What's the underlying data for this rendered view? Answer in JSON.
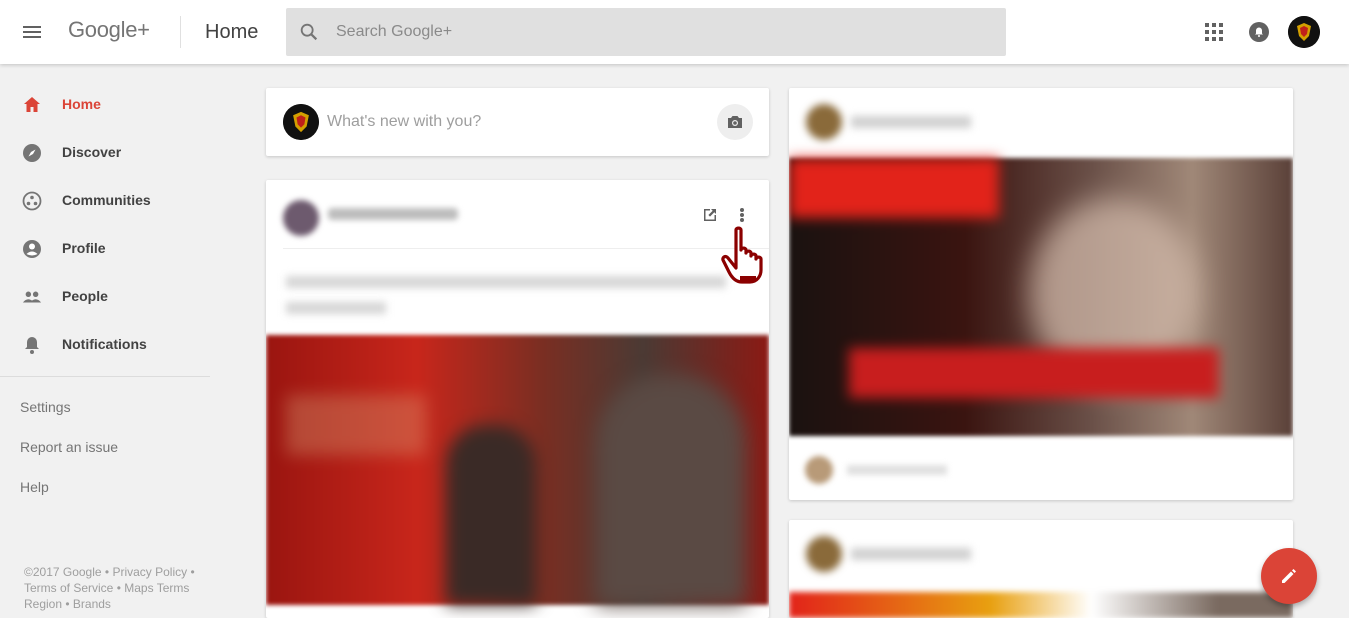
{
  "header": {
    "logo": "Google+",
    "page_title": "Home",
    "search_placeholder": "Search Google+"
  },
  "sidebar": {
    "items": [
      {
        "label": "Home",
        "icon": "home-icon",
        "active": true
      },
      {
        "label": "Discover",
        "icon": "compass-icon"
      },
      {
        "label": "Communities",
        "icon": "communities-icon"
      },
      {
        "label": "Profile",
        "icon": "profile-icon"
      },
      {
        "label": "People",
        "icon": "people-icon"
      },
      {
        "label": "Notifications",
        "icon": "bell-icon"
      }
    ],
    "links": [
      "Settings",
      "Report an issue",
      "Help"
    ],
    "footer": {
      "copyright": "©2017 Google",
      "privacy": "Privacy Policy",
      "terms": "Terms of Service",
      "maps_terms": "Maps Terms",
      "region": "Region",
      "brands": "Brands"
    }
  },
  "composer": {
    "placeholder": "What's new with you?"
  },
  "colors": {
    "accent": "#db4437",
    "hand_cursor": "#8b0000"
  }
}
